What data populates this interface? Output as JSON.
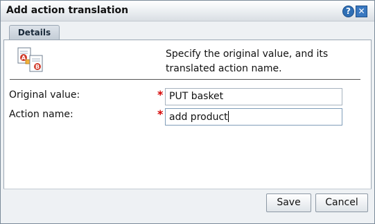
{
  "window": {
    "title": "Add action translation",
    "help_glyph": "?",
    "close_glyph": "✕"
  },
  "tabs": [
    {
      "label": "Details",
      "selected": true
    }
  ],
  "description": "Specify the original value, and its translated action name.",
  "form": {
    "original_value": {
      "label": "Original value:",
      "value": "PUT basket",
      "required": true
    },
    "action_name": {
      "label": "Action name:",
      "value": "add product",
      "required": true
    },
    "required_marker": "*"
  },
  "buttons": {
    "save": "Save",
    "cancel": "Cancel"
  },
  "icons": {
    "help": "help-icon",
    "close": "close-icon",
    "translate": "translate-document-icon"
  },
  "colors": {
    "accent": "#2f6fb5",
    "required": "#d40000",
    "dialog_bg": "#eef1f4"
  }
}
